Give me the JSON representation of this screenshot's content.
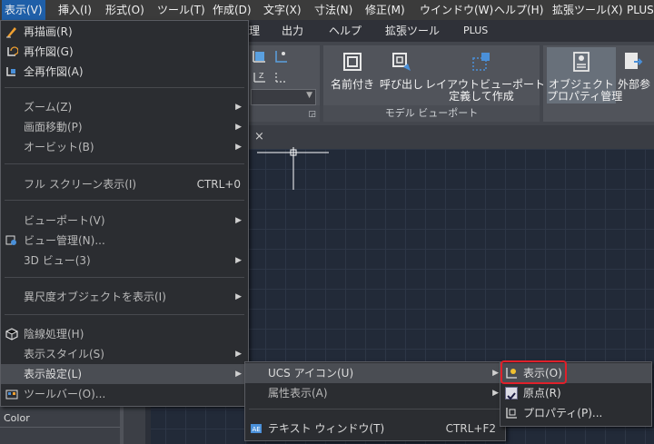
{
  "menubar": {
    "items": [
      "表示(V)",
      "挿入(I)",
      "形式(O)",
      "ツール(T)",
      "作成(D)",
      "文字(X)",
      "寸法(N)",
      "修正(M)",
      "ウインドウ(W)",
      "ヘルプ(H)",
      "拡張ツール(X)",
      "PLUS("
    ]
  },
  "ribbon_tabs": {
    "items": [
      "理",
      "出力",
      "ヘルプ",
      "拡張ツール",
      "PLUS"
    ]
  },
  "ribbon": {
    "named_label": "名前付き",
    "callout_label": "呼び出し",
    "layout_label_1": "レイアウトビューポートを",
    "layout_label_2": "定義して作成",
    "panel_footer": "モデル ビューポート",
    "objprop_label_1": "オブジェクト",
    "objprop_label_2": "プロパティ管理",
    "external_label": "外部参"
  },
  "view_menu": {
    "items": [
      {
        "label": "再描画(R)"
      },
      {
        "label": "再作図(G)"
      },
      {
        "label": "全再作図(A)"
      },
      {
        "label": "ズーム(Z)"
      },
      {
        "label": "画面移動(P)"
      },
      {
        "label": "オービット(B)"
      },
      {
        "label": "フル スクリーン表示(I)",
        "shortcut": "CTRL+0"
      },
      {
        "label": "ビューポート(V)"
      },
      {
        "label": "ビュー管理(N)..."
      },
      {
        "label": "3D ビュー(3)"
      },
      {
        "label": "異尺度オブジェクトを表示(I)"
      },
      {
        "label": "陰線処理(H)"
      },
      {
        "label": "表示スタイル(S)"
      },
      {
        "label": "表示設定(L)"
      },
      {
        "label": "ツールバー(O)..."
      }
    ]
  },
  "display_settings_menu": {
    "items": [
      {
        "label": "UCS アイコン(U)"
      },
      {
        "label": "属性表示(A)"
      },
      {
        "label": "テキスト ウィンドウ(T)",
        "shortcut": "CTRL+F2"
      }
    ]
  },
  "ucs_icon_menu": {
    "items": [
      {
        "label": "表示(O)"
      },
      {
        "label": "原点(R)"
      },
      {
        "label": "プロパティ(P)..."
      }
    ]
  },
  "palette": {
    "label": "Color"
  },
  "colors": {
    "highlight_red": "#e0202a",
    "menu_bg": "#2b2d31",
    "accent_blue": "#1f5fa8"
  }
}
